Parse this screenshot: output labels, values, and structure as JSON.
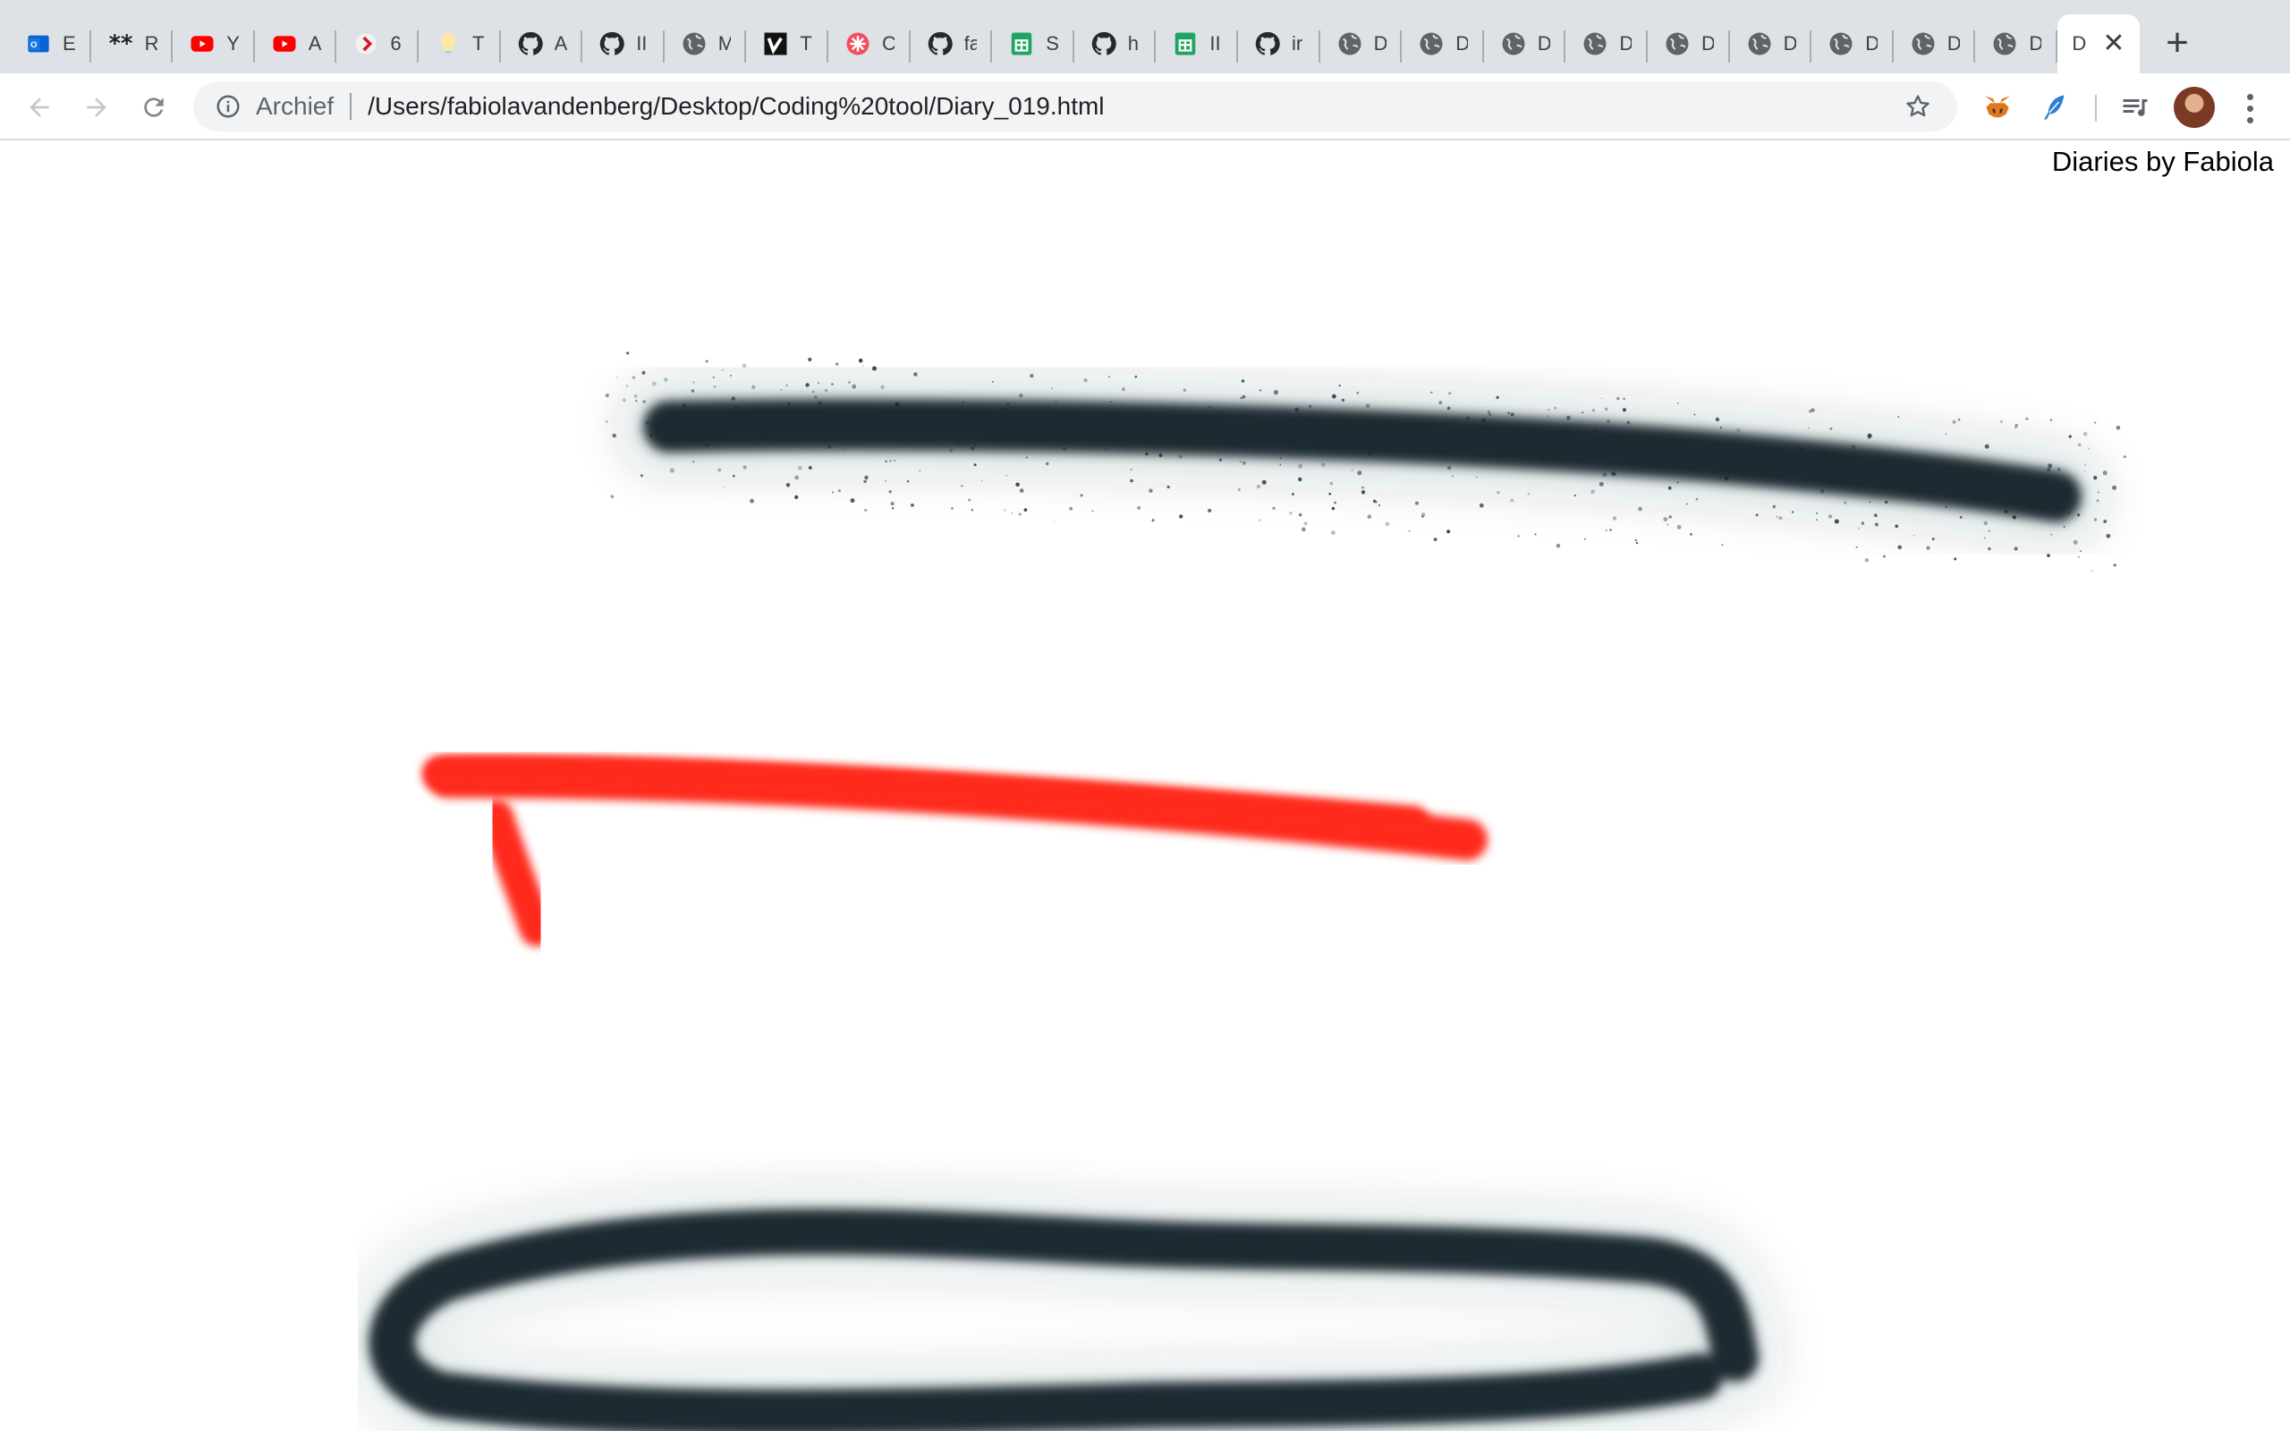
{
  "tabs": [
    {
      "title": "E",
      "icon": "outlook-icon"
    },
    {
      "title": "R",
      "icon": "asterisk-icon"
    },
    {
      "title": "Y",
      "icon": "youtube-icon"
    },
    {
      "title": "A",
      "icon": "youtube-icon"
    },
    {
      "title": "6",
      "icon": "chevron-brand-icon"
    },
    {
      "title": "T",
      "icon": "lightbulb-icon"
    },
    {
      "title": "A",
      "icon": "github-icon"
    },
    {
      "title": "II",
      "icon": "github-icon"
    },
    {
      "title": "M",
      "icon": "globe-icon"
    },
    {
      "title": "T",
      "icon": "vimeo-icon"
    },
    {
      "title": "C",
      "icon": "flower-icon"
    },
    {
      "title": "fa",
      "icon": "github-icon"
    },
    {
      "title": "S",
      "icon": "sheets-icon"
    },
    {
      "title": "h",
      "icon": "github-icon"
    },
    {
      "title": "II",
      "icon": "sheets-icon"
    },
    {
      "title": "ir",
      "icon": "github-icon"
    },
    {
      "title": "D",
      "icon": "globe-icon"
    },
    {
      "title": "D",
      "icon": "globe-icon"
    },
    {
      "title": "D",
      "icon": "globe-icon"
    },
    {
      "title": "D",
      "icon": "globe-icon"
    },
    {
      "title": "D",
      "icon": "globe-icon"
    },
    {
      "title": "D",
      "icon": "globe-icon"
    },
    {
      "title": "D",
      "icon": "globe-icon"
    },
    {
      "title": "D",
      "icon": "globe-icon"
    },
    {
      "title": "D",
      "icon": "globe-icon"
    }
  ],
  "active_tab": {
    "title": "D",
    "close": "✕"
  },
  "new_tab": "+",
  "toolbar": {
    "archive_chip": "Archief",
    "url": "/Users/fabiolavandenberg/Desktop/Coding%20tool/Diary_019.html"
  },
  "page": {
    "site_title": "Diaries by Fabiola"
  },
  "colors": {
    "spray_dark": "#1b2a30",
    "spray_red": "#ff2a1a",
    "tabstrip": "#dee1e6"
  }
}
